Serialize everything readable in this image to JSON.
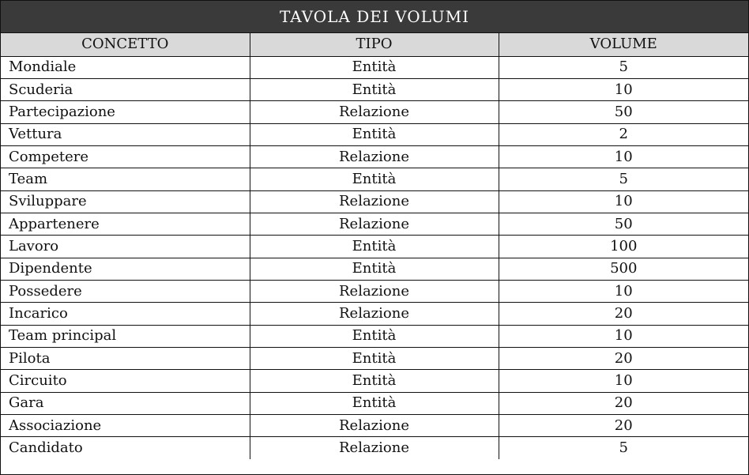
{
  "title": "TAVOLA DEI VOLUMI",
  "columns": {
    "concept": "CONCETTO",
    "type": "TIPO",
    "volume": "VOLUME"
  },
  "rows": [
    {
      "concept": "Mondiale",
      "type": "Entità",
      "volume": "5"
    },
    {
      "concept": "Scuderia",
      "type": "Entità",
      "volume": "10"
    },
    {
      "concept": "Partecipazione",
      "type": "Relazione",
      "volume": "50"
    },
    {
      "concept": "Vettura",
      "type": "Entità",
      "volume": "2"
    },
    {
      "concept": "Competere",
      "type": "Relazione",
      "volume": "10"
    },
    {
      "concept": "Team",
      "type": "Entità",
      "volume": "5"
    },
    {
      "concept": "Sviluppare",
      "type": "Relazione",
      "volume": "10"
    },
    {
      "concept": "Appartenere",
      "type": "Relazione",
      "volume": "50"
    },
    {
      "concept": "Lavoro",
      "type": "Entità",
      "volume": "100"
    },
    {
      "concept": "Dipendente",
      "type": "Entità",
      "volume": "500"
    },
    {
      "concept": "Possedere",
      "type": "Relazione",
      "volume": "10"
    },
    {
      "concept": "Incarico",
      "type": "Relazione",
      "volume": "20"
    },
    {
      "concept": "Team principal",
      "type": "Entità",
      "volume": "10"
    },
    {
      "concept": "Pilota",
      "type": "Entità",
      "volume": "20"
    },
    {
      "concept": "Circuito",
      "type": "Entità",
      "volume": "10"
    },
    {
      "concept": "Gara",
      "type": "Entità",
      "volume": "20"
    },
    {
      "concept": "Associazione",
      "type": "Relazione",
      "volume": "20"
    },
    {
      "concept": "Candidato",
      "type": "Relazione",
      "volume": "5"
    }
  ]
}
